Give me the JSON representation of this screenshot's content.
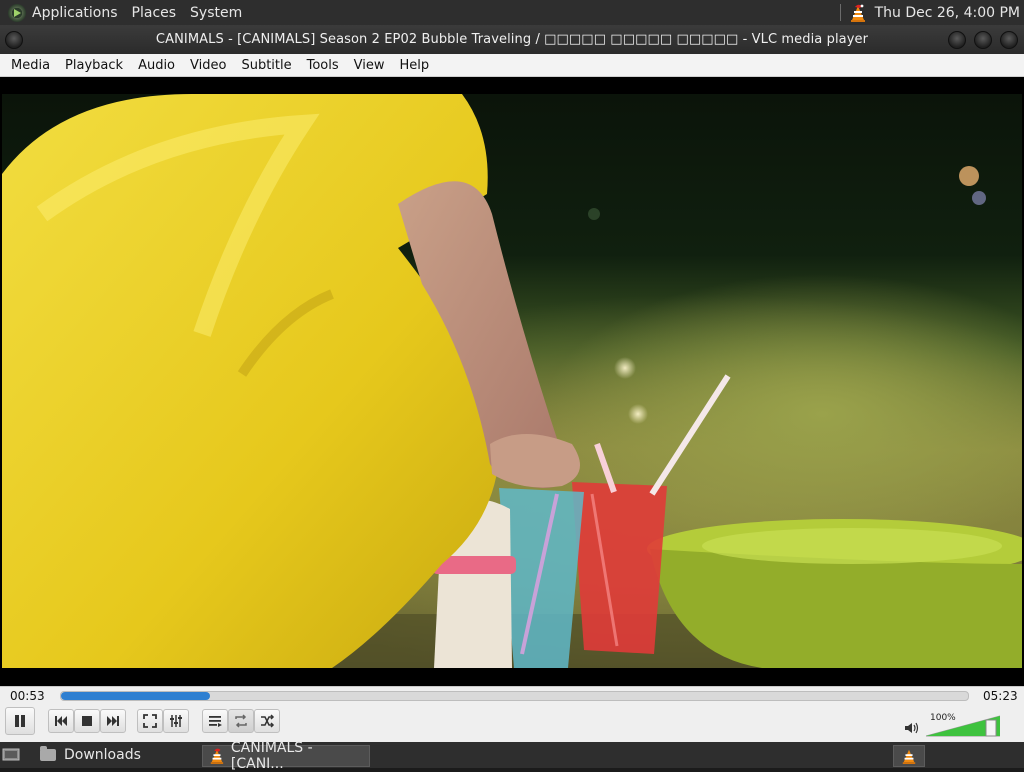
{
  "top_panel": {
    "menus": [
      "Applications",
      "Places",
      "System"
    ],
    "clock": "Thu Dec 26,  4:00 PM"
  },
  "window": {
    "title": "CANIMALS - [CANIMALS] Season 2 EP02 Bubble Traveling / □□□□□ □□□□□ □□□□□ - VLC media player"
  },
  "menubar": {
    "items": [
      {
        "label": "Media"
      },
      {
        "label": "Playback"
      },
      {
        "label": "Audio"
      },
      {
        "label": "Video"
      },
      {
        "label": "Subtitle"
      },
      {
        "label": "Tools"
      },
      {
        "label": "View"
      },
      {
        "label": "Help"
      }
    ]
  },
  "player": {
    "elapsed": "00:53",
    "total": "05:23",
    "progress": 0.164,
    "volume_label": "100%",
    "volume": 1.0
  },
  "taskbar": {
    "items": [
      {
        "label": "Downloads",
        "icon": "folder-icon"
      },
      {
        "label": "CANIMALS - [CANI...",
        "icon": "vlc-cone-icon"
      }
    ]
  },
  "colors": {
    "accent": "#2e7fd1",
    "volume_green": "#3ec23e",
    "panel": "#2e2e2e"
  }
}
